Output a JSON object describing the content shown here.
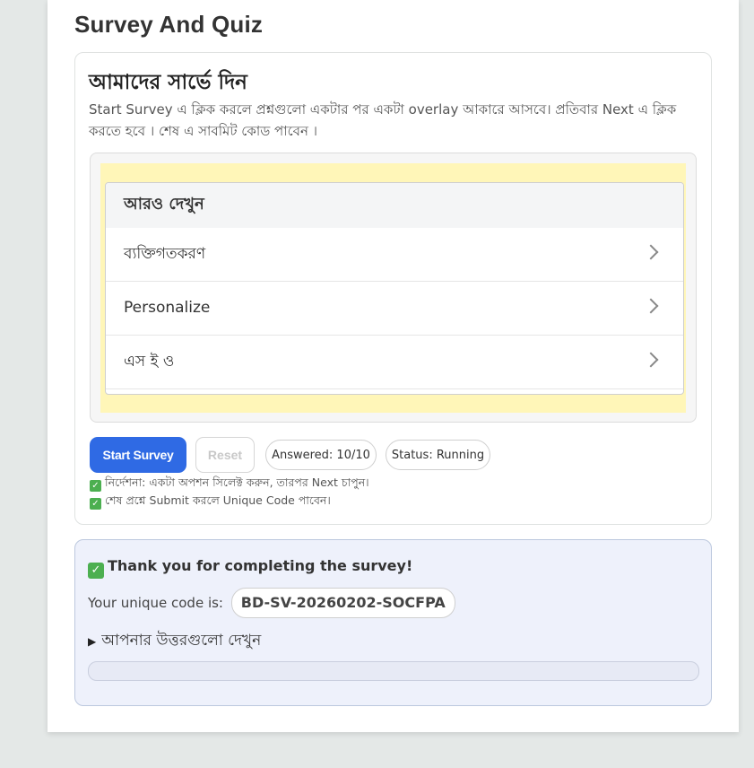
{
  "page": {
    "title": "Survey And Quiz"
  },
  "survey": {
    "heading": "আমাদের সার্ভে দিন",
    "description": "Start Survey এ ক্লিক করলে প্রশ্নগুলো একটার পর একটা overlay আকারে আসবে। প্রতিবার Next এ ক্লিক করতে হবে । শেষ এ সাবমিট কোড পাবেন ।",
    "preview": {
      "header": "আরও দেখুন",
      "items": [
        {
          "label": "ব্যক্তিগতকরণ"
        },
        {
          "label": "Personalize"
        },
        {
          "label": "এস ই ও"
        }
      ]
    },
    "buttons": {
      "start": "Start Survey",
      "reset": "Reset"
    },
    "answered": "Answered: 10/10",
    "status": "Status: Running",
    "notes": [
      "নির্দেশনা: একটা অপশন সিলেক্ট করুন, তারপর Next চাপুন।",
      "শেষ প্রশ্নে Submit করলে Unique Code পাবেন।"
    ]
  },
  "result": {
    "thanks": "Thank you for completing the survey!",
    "code_label": "Your unique code is:",
    "code": "BD-SV-20260202-SOCFPA",
    "details_label": "আপনার উত্তরগুলো দেখুন",
    "progress": 0
  },
  "colors": {
    "accent": "#2f6ae4",
    "check": "#4caf50",
    "highlight": "#fff6b8"
  }
}
